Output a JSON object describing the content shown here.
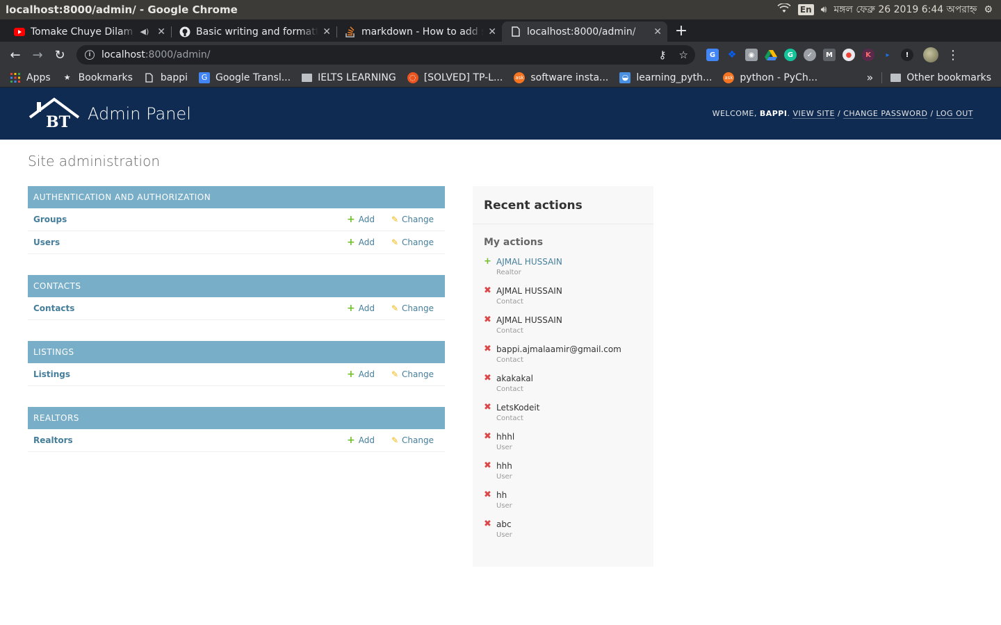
{
  "os": {
    "window_title": "localhost:8000/admin/ - Google Chrome",
    "lang": "En",
    "clock": "মঙ্গল ফেব্রু 26 2019 6:44 অপরাহ্ন"
  },
  "tabs": [
    {
      "title": "Tomake Chuye Dilam G",
      "favicon": "youtube-icon",
      "audio": true,
      "active": false
    },
    {
      "title": "Basic writing and formatti",
      "favicon": "github-icon",
      "audio": false,
      "active": false
    },
    {
      "title": "markdown - How to add s",
      "favicon": "stackoverflow-icon",
      "audio": false,
      "active": false
    },
    {
      "title": "localhost:8000/admin/",
      "favicon": "page-icon",
      "audio": false,
      "active": true
    }
  ],
  "omnibox": {
    "host": "localhost",
    "path": ":8000/admin/"
  },
  "bookmarks": {
    "items": [
      {
        "label": "Apps",
        "icon": "apps-grid-icon"
      },
      {
        "label": "Bookmarks",
        "icon": "star-icon"
      },
      {
        "label": "bappi",
        "icon": "page-icon"
      },
      {
        "label": "Google Transl...",
        "icon": "google-translate-icon"
      },
      {
        "label": "IELTS LEARNING",
        "icon": "folder-icon"
      },
      {
        "label": "[SOLVED] TP-L...",
        "icon": "ubuntu-icon"
      },
      {
        "label": "software insta...",
        "icon": "askubuntu-icon"
      },
      {
        "label": "learning_pyth...",
        "icon": "blue-app-icon"
      },
      {
        "label": "python - PyCh...",
        "icon": "askubuntu-icon"
      }
    ],
    "overflow": "»",
    "other": "Other bookmarks"
  },
  "admin": {
    "brand_title": "Admin Panel",
    "logo_text": "BT",
    "welcome": "Welcome,",
    "username": "bappi",
    "view_site": "View site",
    "change_password": "Change password",
    "log_out": "Log out",
    "sep": "/",
    "page_title": "Site administration"
  },
  "modules": [
    {
      "caption": "Authentication and Authorization",
      "models": [
        {
          "name": "Groups"
        },
        {
          "name": "Users"
        }
      ]
    },
    {
      "caption": "Contacts",
      "models": [
        {
          "name": "Contacts"
        }
      ]
    },
    {
      "caption": "Listings",
      "models": [
        {
          "name": "Listings"
        }
      ]
    },
    {
      "caption": "Realtors",
      "models": [
        {
          "name": "Realtors"
        }
      ]
    }
  ],
  "labels": {
    "add": "Add",
    "change": "Change"
  },
  "recent": {
    "title": "Recent actions",
    "my_actions": "My actions",
    "items": [
      {
        "icon": "add",
        "text": "AJMAL HUSSAIN",
        "type": "Realtor",
        "link": true
      },
      {
        "icon": "del",
        "text": "AJMAL HUSSAIN",
        "type": "Contact",
        "link": false
      },
      {
        "icon": "del",
        "text": "AJMAL HUSSAIN",
        "type": "Contact",
        "link": false
      },
      {
        "icon": "del",
        "text": "bappi.ajmalaamir@gmail.com",
        "type": "Contact",
        "link": false
      },
      {
        "icon": "del",
        "text": "akakakal",
        "type": "Contact",
        "link": false
      },
      {
        "icon": "del",
        "text": "LetsKodeit",
        "type": "Contact",
        "link": false
      },
      {
        "icon": "del",
        "text": "hhhl",
        "type": "User",
        "link": false
      },
      {
        "icon": "del",
        "text": "hhh",
        "type": "User",
        "link": false
      },
      {
        "icon": "del",
        "text": "hh",
        "type": "User",
        "link": false
      },
      {
        "icon": "del",
        "text": "abc",
        "type": "User",
        "link": false
      }
    ]
  }
}
